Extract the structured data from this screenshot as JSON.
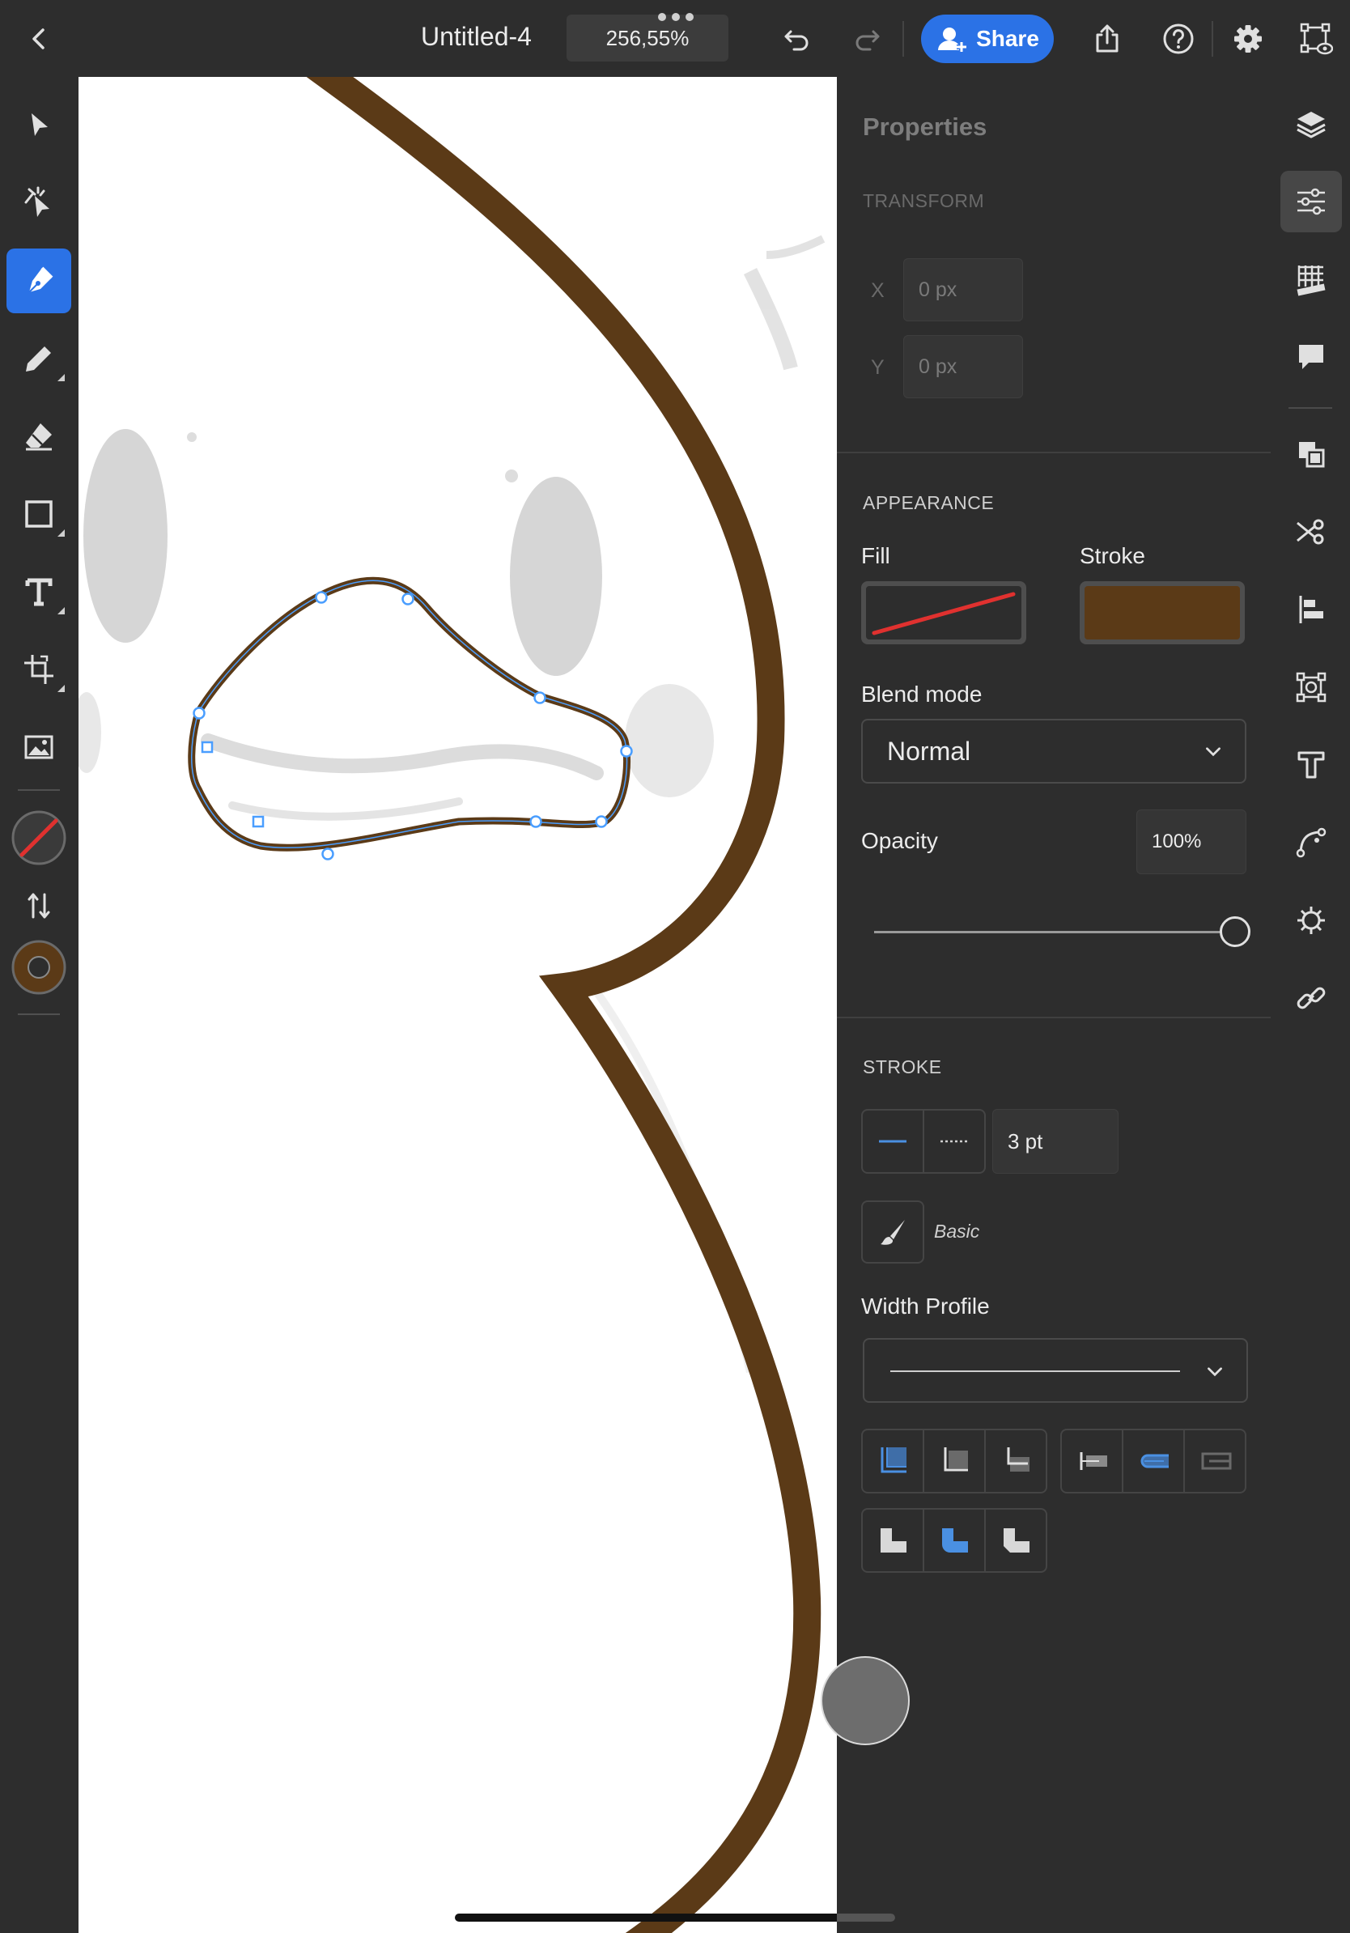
{
  "topbar": {
    "doc_title": "Untitled-4",
    "zoom": "256,55%",
    "share_label": "Share"
  },
  "left_tools": {
    "items": [
      "select",
      "direct-select",
      "pen",
      "pencil",
      "eraser",
      "shape",
      "text",
      "transform",
      "image",
      "fill-stroke",
      "swap",
      "stroke-color"
    ],
    "active": "pen"
  },
  "panel": {
    "heading": "Properties",
    "transform": {
      "section": "TRANSFORM",
      "x_label": "X",
      "x_value": "0 px",
      "y_label": "Y",
      "y_value": "0 px"
    },
    "appearance": {
      "section": "APPEARANCE",
      "fill_label": "Fill",
      "fill": "none",
      "stroke_label": "Stroke",
      "stroke_color": "#5b3a17",
      "blend_label": "Blend mode",
      "blend_value": "Normal",
      "opacity_label": "Opacity",
      "opacity_value": "100%",
      "opacity_fraction": 1.0
    },
    "stroke": {
      "section": "STROKE",
      "weight": "3 pt",
      "brush_label": "Basic",
      "width_profile_label": "Width Profile"
    }
  },
  "right_rail": {
    "items": [
      "layers",
      "properties",
      "grid",
      "comments",
      "arrange",
      "scissors",
      "align",
      "repeat",
      "type",
      "path",
      "plugins",
      "links"
    ],
    "active": "properties"
  },
  "colors": {
    "accent": "#2b72e6",
    "stroke": "#5b3a17",
    "panel_bg": "#2d2d2d",
    "selection": "#4a9eff"
  }
}
